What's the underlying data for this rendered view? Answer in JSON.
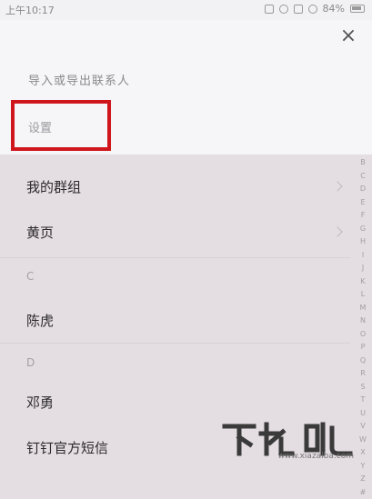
{
  "status_bar": {
    "time": "上午10:17",
    "battery": "84%"
  },
  "sheet": {
    "close_glyph": "×",
    "export_label": "导入或导出联系人",
    "settings_label": "设置"
  },
  "list": {
    "items": [
      {
        "label": "我的群组",
        "chevron": true
      },
      {
        "label": "黄页",
        "chevron": true
      }
    ],
    "sections": [
      {
        "header": "C",
        "contacts": [
          "陈虎"
        ]
      },
      {
        "header": "D",
        "contacts": [
          "邓勇",
          "钉钉官方短信"
        ]
      }
    ]
  },
  "alphabet_index": [
    "B",
    "C",
    "D",
    "E",
    "F",
    "G",
    "H",
    "I",
    "J",
    "K",
    "L",
    "M",
    "N",
    "O",
    "P",
    "Q",
    "R",
    "S",
    "T",
    "U",
    "V",
    "W",
    "X",
    "Y",
    "Z",
    "#"
  ],
  "watermark": {
    "logo_text": "下载吧",
    "url": "www.xiazaiba.com"
  },
  "colors": {
    "highlight_box": "#d0161d",
    "list_background": "#e4dde2",
    "sheet_background": "#f6f5f8"
  }
}
